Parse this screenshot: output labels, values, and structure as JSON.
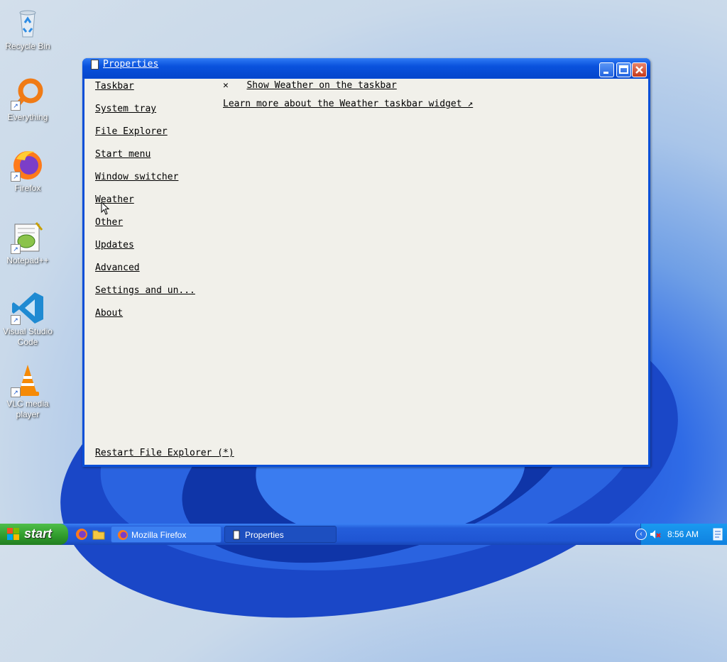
{
  "desktop": {
    "icons": [
      {
        "label": "Recycle Bin",
        "icon": "recycle-bin-icon"
      },
      {
        "label": "Everything",
        "icon": "search-magnifier-icon"
      },
      {
        "label": "Firefox",
        "icon": "firefox-icon"
      },
      {
        "label": "Notepad++",
        "icon": "notepad-plus-plus-icon"
      },
      {
        "label": "Visual Studio Code",
        "icon": "vscode-icon"
      },
      {
        "label": "VLC media player",
        "icon": "vlc-cone-icon"
      }
    ]
  },
  "window": {
    "title": "Properties",
    "nav": [
      {
        "label": "Taskbar"
      },
      {
        "label": "System tray"
      },
      {
        "label": "File Explorer"
      },
      {
        "label": "Start menu"
      },
      {
        "label": "Window switcher"
      },
      {
        "label": "Weather"
      },
      {
        "label": "Other"
      },
      {
        "label": "Updates"
      },
      {
        "label": "Advanced"
      },
      {
        "label": "Settings and un..."
      },
      {
        "label": "About"
      }
    ],
    "content": {
      "checkbox_mark": "✕",
      "checkbox_label": "Show Weather on the taskbar",
      "learn_more": "Learn more about the Weather taskbar widget ↗"
    },
    "restart_label": "Restart File Explorer (*)"
  },
  "taskbar": {
    "start_label": "start",
    "tasks": [
      {
        "label": "Mozilla Firefox",
        "icon": "firefox-icon"
      },
      {
        "label": "Properties",
        "icon": "properties-window-icon"
      }
    ],
    "clock": "8:56 AM"
  }
}
